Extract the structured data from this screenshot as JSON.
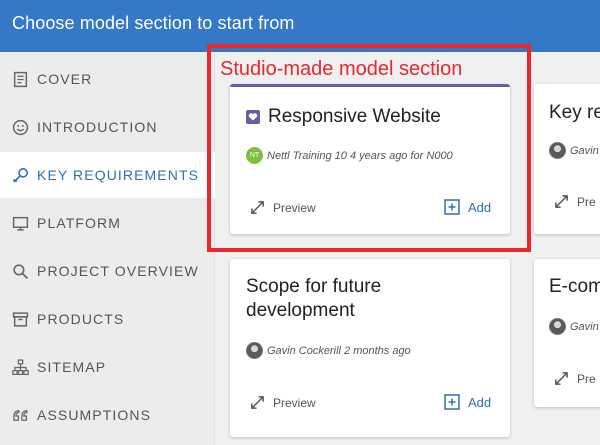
{
  "header": {
    "title": "Choose model section to start from"
  },
  "sidebar": {
    "items": [
      {
        "label": "COVER",
        "icon": "cover-icon"
      },
      {
        "label": "INTRODUCTION",
        "icon": "smiley-icon"
      },
      {
        "label": "KEY REQUIREMENTS",
        "icon": "key-icon",
        "active": true
      },
      {
        "label": "PLATFORM",
        "icon": "monitor-icon"
      },
      {
        "label": "PROJECT OVERVIEW",
        "icon": "search-icon"
      },
      {
        "label": "PRODUCTS",
        "icon": "archive-icon"
      },
      {
        "label": "SITEMAP",
        "icon": "sitemap-icon"
      },
      {
        "label": "ASSUMPTIONS",
        "icon": "quote-icon"
      }
    ]
  },
  "cards": [
    {
      "title": "Responsive Website",
      "meta": "Nettl Training 10 4 years ago for N000",
      "avatar_text": "NT",
      "preview": "Preview",
      "add": "Add"
    },
    {
      "title": "Key re",
      "meta": "Gavin",
      "preview": "Pre"
    },
    {
      "title_line1": "Scope for future",
      "title_line2": "development",
      "meta": "Gavin Cockerill 2 months ago",
      "preview": "Preview",
      "add": "Add"
    },
    {
      "title": "E-com",
      "meta": "Gavin",
      "preview": "Pre"
    }
  ],
  "annotation": {
    "label": "Studio-made model section"
  },
  "colors": {
    "header": "#3478c6",
    "accent": "#2f6fb7",
    "studio_bar": "#6b5aa6",
    "annotation": "#e8282b"
  }
}
